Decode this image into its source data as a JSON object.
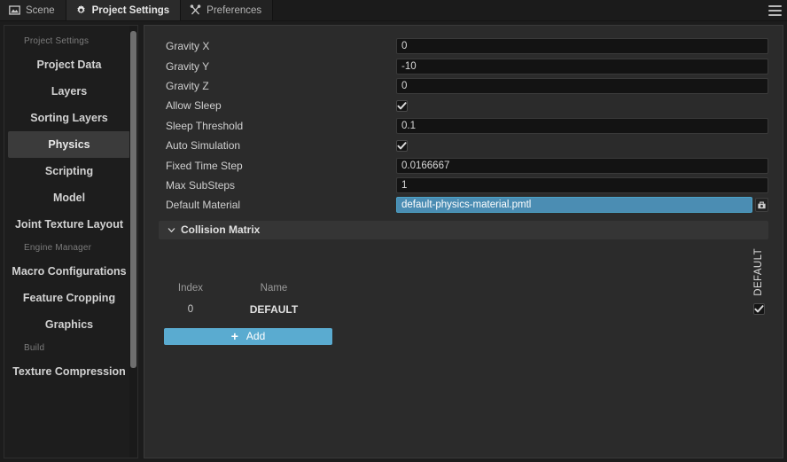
{
  "tabbar": {
    "tabs": [
      {
        "label": "Scene",
        "icon": "image-icon",
        "active": false
      },
      {
        "label": "Project Settings",
        "icon": "gear-icon",
        "active": true
      },
      {
        "label": "Preferences",
        "icon": "tools-icon",
        "active": false
      }
    ],
    "menu_icon": "hamburger-menu-icon"
  },
  "sidebar": {
    "groups": [
      {
        "label": "Project Settings",
        "items": [
          {
            "label": "Project Data",
            "selected": false
          },
          {
            "label": "Layers",
            "selected": false
          },
          {
            "label": "Sorting Layers",
            "selected": false
          },
          {
            "label": "Physics",
            "selected": true
          },
          {
            "label": "Scripting",
            "selected": false
          },
          {
            "label": "Model",
            "selected": false
          },
          {
            "label": "Joint Texture Layout",
            "selected": false
          }
        ]
      },
      {
        "label": "Engine Manager",
        "items": [
          {
            "label": "Macro Configurations",
            "selected": false
          },
          {
            "label": "Feature Cropping",
            "selected": false
          },
          {
            "label": "Graphics",
            "selected": false
          }
        ]
      },
      {
        "label": "Build",
        "items": [
          {
            "label": "Texture Compression",
            "selected": false
          }
        ]
      }
    ]
  },
  "main": {
    "properties": [
      {
        "label": "Gravity X",
        "type": "text",
        "value": "0"
      },
      {
        "label": "Gravity Y",
        "type": "text",
        "value": "-10"
      },
      {
        "label": "Gravity Z",
        "type": "text",
        "value": "0"
      },
      {
        "label": "Allow Sleep",
        "type": "checkbox",
        "value": "checked"
      },
      {
        "label": "Sleep Threshold",
        "type": "text",
        "value": "0.1"
      },
      {
        "label": "Auto Simulation",
        "type": "checkbox",
        "value": "checked"
      },
      {
        "label": "Fixed Time Step",
        "type": "text",
        "value": "0.0166667"
      },
      {
        "label": "Max SubSteps",
        "type": "text",
        "value": "1"
      },
      {
        "label": "Default Material",
        "type": "asset",
        "value": "default-physics-material.pmtl"
      }
    ],
    "collision_matrix": {
      "title": "Collision Matrix",
      "collapse_icon": "chevron-down-icon",
      "columns": {
        "index": "Index",
        "name": "Name",
        "rotated": [
          "DEFAULT"
        ]
      },
      "rows": [
        {
          "index": "0",
          "name": "DEFAULT",
          "checks": [
            "checked"
          ]
        }
      ],
      "add_button": {
        "label": "Add",
        "icon": "plus-icon"
      }
    }
  },
  "colors": {
    "accent": "#5aabd0",
    "asset_field": "#4b8db3",
    "selected_item": "#3b3b3b",
    "panel_bg": "#2b2b2b",
    "sidebar_bg": "#1d1d1d"
  }
}
